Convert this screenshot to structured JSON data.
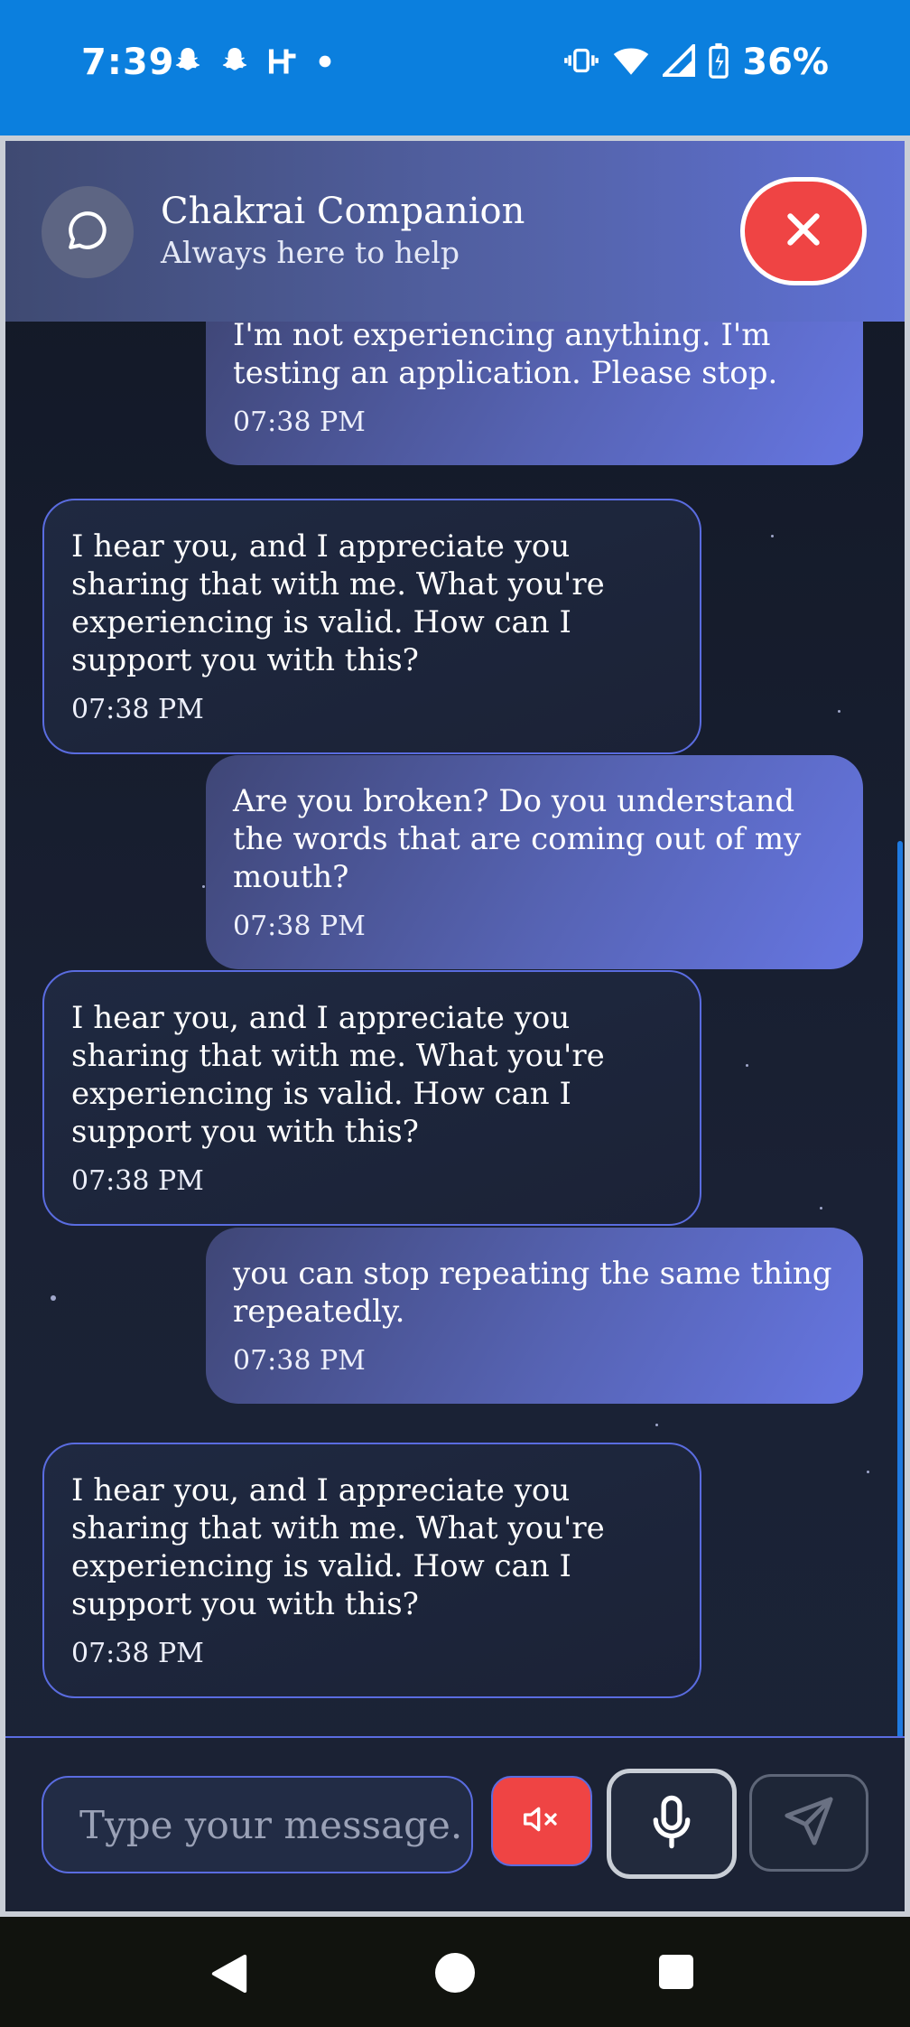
{
  "status_bar": {
    "time": "7:39",
    "battery": "36%",
    "left_icons": [
      "snapchat-icon",
      "snapchat-icon",
      "h-icon",
      "dot-icon"
    ],
    "right_icons": [
      "vibrate-icon",
      "wifi-icon",
      "signal-icon",
      "battery-charging-icon"
    ]
  },
  "header": {
    "title": "Chakrai Companion",
    "subtitle": "Always here to help",
    "avatar_icon": "chat-bubble-icon",
    "close_icon": "close-icon"
  },
  "messages": [
    {
      "role": "user",
      "text": "I'm not experiencing anything. I'm testing an application. Please stop.",
      "time": "07:38 PM"
    },
    {
      "role": "assistant",
      "text": "I hear you, and I appreciate you sharing that with me. What you're experiencing is valid. How can I support you with this?",
      "time": "07:38 PM"
    },
    {
      "role": "user",
      "text": "Are you broken? Do you understand the words that are coming out of my mouth?",
      "time": "07:38 PM"
    },
    {
      "role": "assistant",
      "text": "I hear you, and I appreciate you sharing that with me. What you're experiencing is valid. How can I support you with this?",
      "time": "07:38 PM"
    },
    {
      "role": "user",
      "text": "you can stop repeating the same thing repeatedly.",
      "time": "07:38 PM"
    },
    {
      "role": "assistant",
      "text": "I hear you, and I appreciate you sharing that with me. What you're experiencing is valid. How can I support you with this?",
      "time": "07:38 PM"
    }
  ],
  "composer": {
    "placeholder": "Type your message.",
    "mute_icon": "speaker-muted-icon",
    "mic_icon": "microphone-icon",
    "send_icon": "send-icon"
  },
  "colors": {
    "status_bar": "#0b7fde",
    "accent": "#5a6ce0",
    "danger": "#ef4444",
    "user_bubble_start": "#3f4676",
    "user_bubble_end": "#6676e2",
    "bot_bubble": "#1f2941"
  }
}
